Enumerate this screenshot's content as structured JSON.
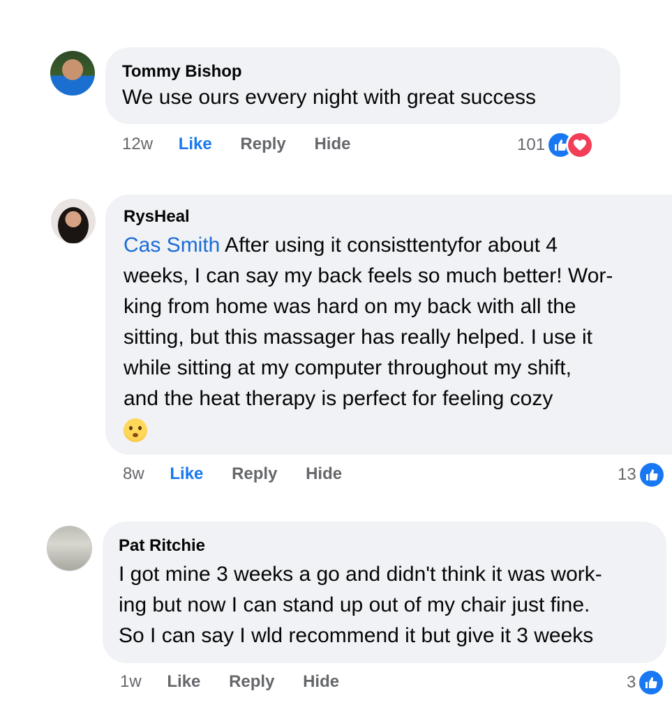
{
  "comments": [
    {
      "author": "Tommy Bishop",
      "text": "We use ours evvery night with great success",
      "time": "12w",
      "like_label": "Like",
      "reply_label": "Reply",
      "hide_label": "Hide",
      "reaction_count": "101",
      "reactions": [
        "like-icon",
        "love-icon"
      ]
    },
    {
      "author": "RysHeal",
      "mention": "Cas Smith",
      "text": " After using it consisttentyfor about 4\nweeks, I can say my back feels so much better! Wor-\nking from home was hard on my back with all the\nsitting, but this massager has really helped. I use it\nwhile sitting at my computer throughout my shift,\nand the heat therapy is perfect for feeling cozy",
      "emoji": "flushed-face-emoji",
      "time": "8w",
      "like_label": "Like",
      "reply_label": "Reply",
      "hide_label": "Hide",
      "reaction_count": "13",
      "reactions": [
        "like-icon"
      ]
    },
    {
      "author": "Pat Ritchie",
      "text": "I got mine 3 weeks a go and didn't think it was work-\ning but now I can stand up out of my chair just fine.\nSo I can say I wld recommend it but give it 3 weeks",
      "time": "1w",
      "like_label": "Like",
      "reply_label": "Reply",
      "hide_label": "Hide",
      "reaction_count": "3",
      "reactions": [
        "like-icon"
      ]
    }
  ],
  "colors": {
    "bubble": "#f0f2f5",
    "like_active": "#1877f2",
    "meta": "#65676b",
    "mention": "#1a6bd6",
    "love": "#f33e58"
  }
}
